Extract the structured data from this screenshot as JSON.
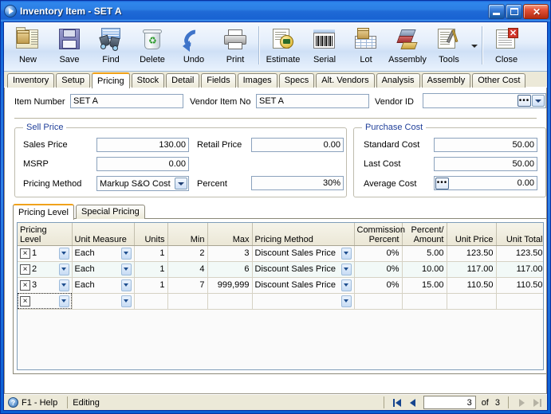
{
  "window": {
    "title_main": "Inventory Item",
    "title_sep": " - ",
    "title_item": "SET A",
    "app_icon": "play-circle-icon",
    "minimize_label": "_",
    "maximize_label": "",
    "close_label": "✕"
  },
  "toolbar": {
    "buttons": [
      {
        "label": "New",
        "icon": "new-item-icon"
      },
      {
        "label": "Save",
        "icon": "floppy-disk-icon"
      },
      {
        "label": "Find",
        "icon": "binoculars-icon"
      },
      {
        "label": "Delete",
        "icon": "recycle-bin-icon"
      },
      {
        "label": "Undo",
        "icon": "undo-arrow-icon"
      },
      {
        "label": "Print",
        "icon": "printer-icon"
      },
      {
        "label": "Estimate",
        "icon": "estimate-seal-icon"
      },
      {
        "label": "Serial",
        "icon": "barcode-icon"
      },
      {
        "label": "Lot",
        "icon": "lot-box-icon"
      },
      {
        "label": "Assembly",
        "icon": "assembly-layers-icon"
      },
      {
        "label": "Tools",
        "icon": "tools-wrench-icon"
      },
      {
        "label": "Close",
        "icon": "close-document-icon"
      }
    ],
    "dropdown_caret": "chevron-down-icon"
  },
  "tabs": {
    "items": [
      "Inventory",
      "Setup",
      "Pricing",
      "Stock",
      "Detail",
      "Fields",
      "Images",
      "Specs",
      "Alt. Vendors",
      "Analysis",
      "Assembly",
      "Other Cost"
    ],
    "active": "Pricing"
  },
  "header_fields": {
    "item_number_label": "Item Number",
    "item_number_value": "SET A",
    "vendor_item_label": "Vendor Item No",
    "vendor_item_value": "SET A",
    "vendor_id_label": "Vendor ID",
    "vendor_id_value": "",
    "vendor_id_ellipsis": "•••"
  },
  "sell_price": {
    "legend": "Sell Price",
    "sales_price_label": "Sales Price",
    "sales_price_value": "130.00",
    "msrp_label": "MSRP",
    "msrp_value": "0.00",
    "pricing_method_label": "Pricing Method",
    "pricing_method_value": "Markup S&O Cost",
    "retail_price_label": "Retail Price",
    "retail_price_value": "0.00",
    "percent_label": "Percent",
    "percent_value": "30%"
  },
  "purchase_cost": {
    "legend": "Purchase Cost",
    "standard_cost_label": "Standard Cost",
    "standard_cost_value": "50.00",
    "last_cost_label": "Last Cost",
    "last_cost_value": "50.00",
    "average_cost_label": "Average Cost",
    "average_cost_value": "0.00",
    "average_cost_ellipsis": "•••"
  },
  "inner_tabs": {
    "items": [
      "Pricing Level",
      "Special Pricing"
    ],
    "active": "Pricing Level"
  },
  "grid": {
    "columns": [
      {
        "key": "level",
        "label": "Pricing\nLevel",
        "align": "l"
      },
      {
        "key": "uom",
        "label": "Unit Measure",
        "align": "l"
      },
      {
        "key": "units",
        "label": "Units",
        "align": "r"
      },
      {
        "key": "min",
        "label": "Min",
        "align": "r"
      },
      {
        "key": "max",
        "label": "Max",
        "align": "r"
      },
      {
        "key": "method",
        "label": "Pricing Method",
        "align": "l"
      },
      {
        "key": "commission",
        "label": "Commission\nPercent",
        "align": "r"
      },
      {
        "key": "percent",
        "label": "Percent/\nAmount",
        "align": "r"
      },
      {
        "key": "unitprice",
        "label": "Unit Price",
        "align": "r"
      },
      {
        "key": "unittotal",
        "label": "Unit Total",
        "align": "r"
      }
    ],
    "delete_glyph": "×",
    "rows": [
      {
        "level": "1",
        "uom": "Each",
        "units": "1",
        "min": "2",
        "max": "3",
        "method": "Discount Sales Price",
        "commission": "0%",
        "percent": "5.00",
        "unitprice": "123.50",
        "unittotal": "123.50"
      },
      {
        "level": "2",
        "uom": "Each",
        "units": "1",
        "min": "4",
        "max": "6",
        "method": "Discount Sales Price",
        "commission": "0%",
        "percent": "10.00",
        "unitprice": "117.00",
        "unittotal": "117.00"
      },
      {
        "level": "3",
        "uom": "Each",
        "units": "1",
        "min": "7",
        "max": "999,999",
        "method": "Discount Sales Price",
        "commission": "0%",
        "percent": "15.00",
        "unitprice": "110.50",
        "unittotal": "110.50"
      },
      {
        "level": "",
        "uom": "",
        "units": "",
        "min": "",
        "max": "",
        "method": "",
        "commission": "",
        "percent": "",
        "unitprice": "",
        "unittotal": ""
      }
    ]
  },
  "statusbar": {
    "help_text": "F1 - Help",
    "help_icon": "question-mark-icon",
    "mode_text": "Editing",
    "record_current": "3",
    "record_of": "of",
    "record_total": "3",
    "first_icon": "first-record-icon",
    "prev_icon": "previous-record-icon",
    "next_icon": "next-record-icon",
    "last_icon": "last-record-icon"
  },
  "colors": {
    "title_blue": "#0a5fd4",
    "accent_orange": "#f0a21c",
    "legend_blue": "#21409a",
    "face": "#ece9d8"
  }
}
